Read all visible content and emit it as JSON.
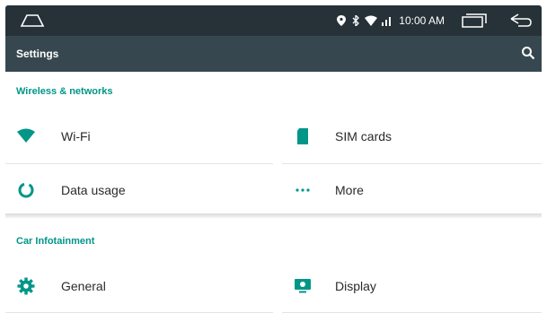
{
  "status_bar": {
    "time": "10:00 AM",
    "icons": [
      "location-icon",
      "bluetooth-icon",
      "wifi-signal-icon",
      "cell-signal-icon"
    ]
  },
  "toolbar": {
    "title": "Settings",
    "search_icon": "search-icon"
  },
  "sections": [
    {
      "header": "Wireless & networks",
      "items": [
        {
          "label": "Wi-Fi",
          "icon": "wifi-icon"
        },
        {
          "label": "SIM cards",
          "icon": "sim-card-icon"
        },
        {
          "label": "Data usage",
          "icon": "data-usage-icon"
        },
        {
          "label": "More",
          "icon": "more-dots-icon"
        }
      ]
    },
    {
      "header": "Car Infotainment",
      "items": [
        {
          "label": "General",
          "icon": "gear-icon"
        },
        {
          "label": "Display",
          "icon": "display-icon"
        }
      ]
    }
  ],
  "colors": {
    "accent": "#009688",
    "status_bar": "#263238",
    "toolbar": "#37474f"
  }
}
